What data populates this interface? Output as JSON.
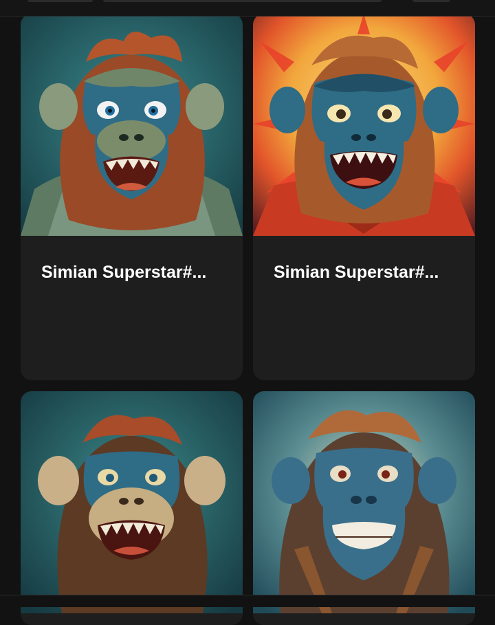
{
  "nft_grid": {
    "cards": [
      {
        "title": "Simian Superstar#...",
        "art_description": "ape-portrait-green",
        "bg_color": "#2a6f74",
        "fur_color": "#9a4a26",
        "face_color": "#2f6c86"
      },
      {
        "title": "Simian Superstar#...",
        "art_description": "ape-portrait-sunburst",
        "bg_color": "#e86428",
        "fur_color": "#a65a2c",
        "face_color": "#2f6c86"
      },
      {
        "title": "",
        "art_description": "ape-portrait-tan",
        "bg_color": "#2a6b70",
        "fur_color": "#5c3a24",
        "face_color": "#2f6c86"
      },
      {
        "title": "",
        "art_description": "ape-portrait-brown",
        "bg_color": "#2e6a75",
        "fur_color": "#5b4030",
        "face_color": "#3a6f8b"
      }
    ]
  }
}
